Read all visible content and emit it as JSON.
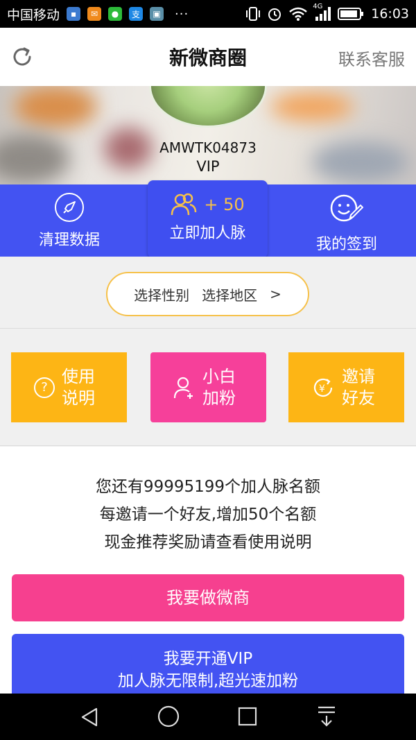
{
  "status_bar": {
    "carrier": "中国移动",
    "network": "4G",
    "time": "16:03",
    "more": "···"
  },
  "header": {
    "title": "新微商圈",
    "contact_label": "联系客服"
  },
  "profile": {
    "user_id": "AMWTK04873",
    "level": "VIP"
  },
  "actions": [
    {
      "label": "清理数据",
      "icon": "rocket-icon"
    },
    {
      "label": "立即加人脉",
      "badge": "+ 50",
      "icon": "add-users-icon"
    },
    {
      "label": "我的签到",
      "icon": "smile-edit-icon"
    }
  ],
  "filter": {
    "gender_label": "选择性别",
    "region_label": "选择地区",
    "arrow": ">"
  },
  "tiles": [
    {
      "line1": "使用",
      "line2": "说明",
      "icon": "question-icon",
      "color": "#fdb515"
    },
    {
      "line1": "小白",
      "line2": "加粉",
      "icon": "add-user-icon",
      "color": "#f6409a"
    },
    {
      "line1": "邀请",
      "line2": "好友",
      "icon": "yen-refresh-icon",
      "color": "#fdb515"
    }
  ],
  "info": {
    "line1": "您还有99995199个加人脉名额",
    "line2": "每邀请一个好友,增加50个名额",
    "line3": "现金推荐奖励请查看使用说明"
  },
  "buttons": {
    "weishang_label": "我要做微商",
    "vip_line1": "我要开通VIP",
    "vip_line2": "加人脉无限制,超光速加粉"
  },
  "colors": {
    "primary_blue": "#4353f2",
    "pink": "#f6408f",
    "amber": "#fdb515",
    "pill_border": "#f6c14a"
  }
}
